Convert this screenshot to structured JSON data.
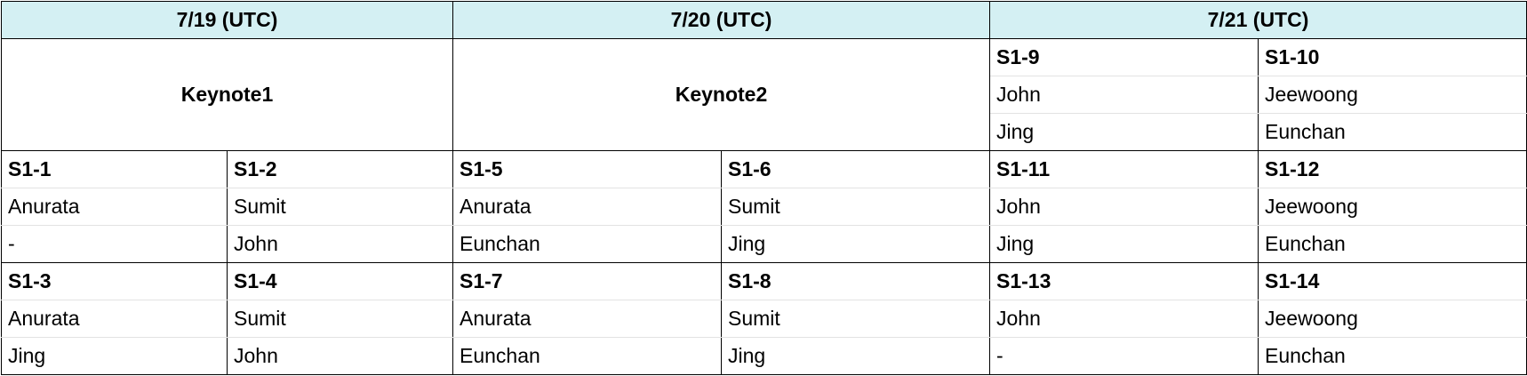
{
  "days": [
    {
      "label": "7/19 (UTC)"
    },
    {
      "label": "7/20 (UTC)"
    },
    {
      "label": "7/21 (UTC)"
    }
  ],
  "keynotes": [
    {
      "label": "Keynote1"
    },
    {
      "label": "Keynote2"
    }
  ],
  "day3_top": [
    {
      "session": "S1-9",
      "person1": "John",
      "person2": "Jing"
    },
    {
      "session": "S1-10",
      "person1": "Jeewoong",
      "person2": "Eunchan"
    }
  ],
  "block1": [
    {
      "session": "S1-1",
      "person1": "Anurata",
      "person2": "-"
    },
    {
      "session": "S1-2",
      "person1": "Sumit",
      "person2": "John"
    },
    {
      "session": "S1-5",
      "person1": "Anurata",
      "person2": "Eunchan"
    },
    {
      "session": "S1-6",
      "person1": "Sumit",
      "person2": "Jing"
    },
    {
      "session": "S1-11",
      "person1": "John",
      "person2": "Jing"
    },
    {
      "session": "S1-12",
      "person1": "Jeewoong",
      "person2": "Eunchan"
    }
  ],
  "block2": [
    {
      "session": "S1-3",
      "person1": "Anurata",
      "person2": "Jing"
    },
    {
      "session": "S1-4",
      "person1": "Sumit",
      "person2": "John"
    },
    {
      "session": "S1-7",
      "person1": "Anurata",
      "person2": "Eunchan"
    },
    {
      "session": "S1-8",
      "person1": "Sumit",
      "person2": "Jing"
    },
    {
      "session": "S1-13",
      "person1": "John",
      "person2": "-"
    },
    {
      "session": "S1-14",
      "person1": "Jeewoong",
      "person2": "Eunchan"
    }
  ]
}
